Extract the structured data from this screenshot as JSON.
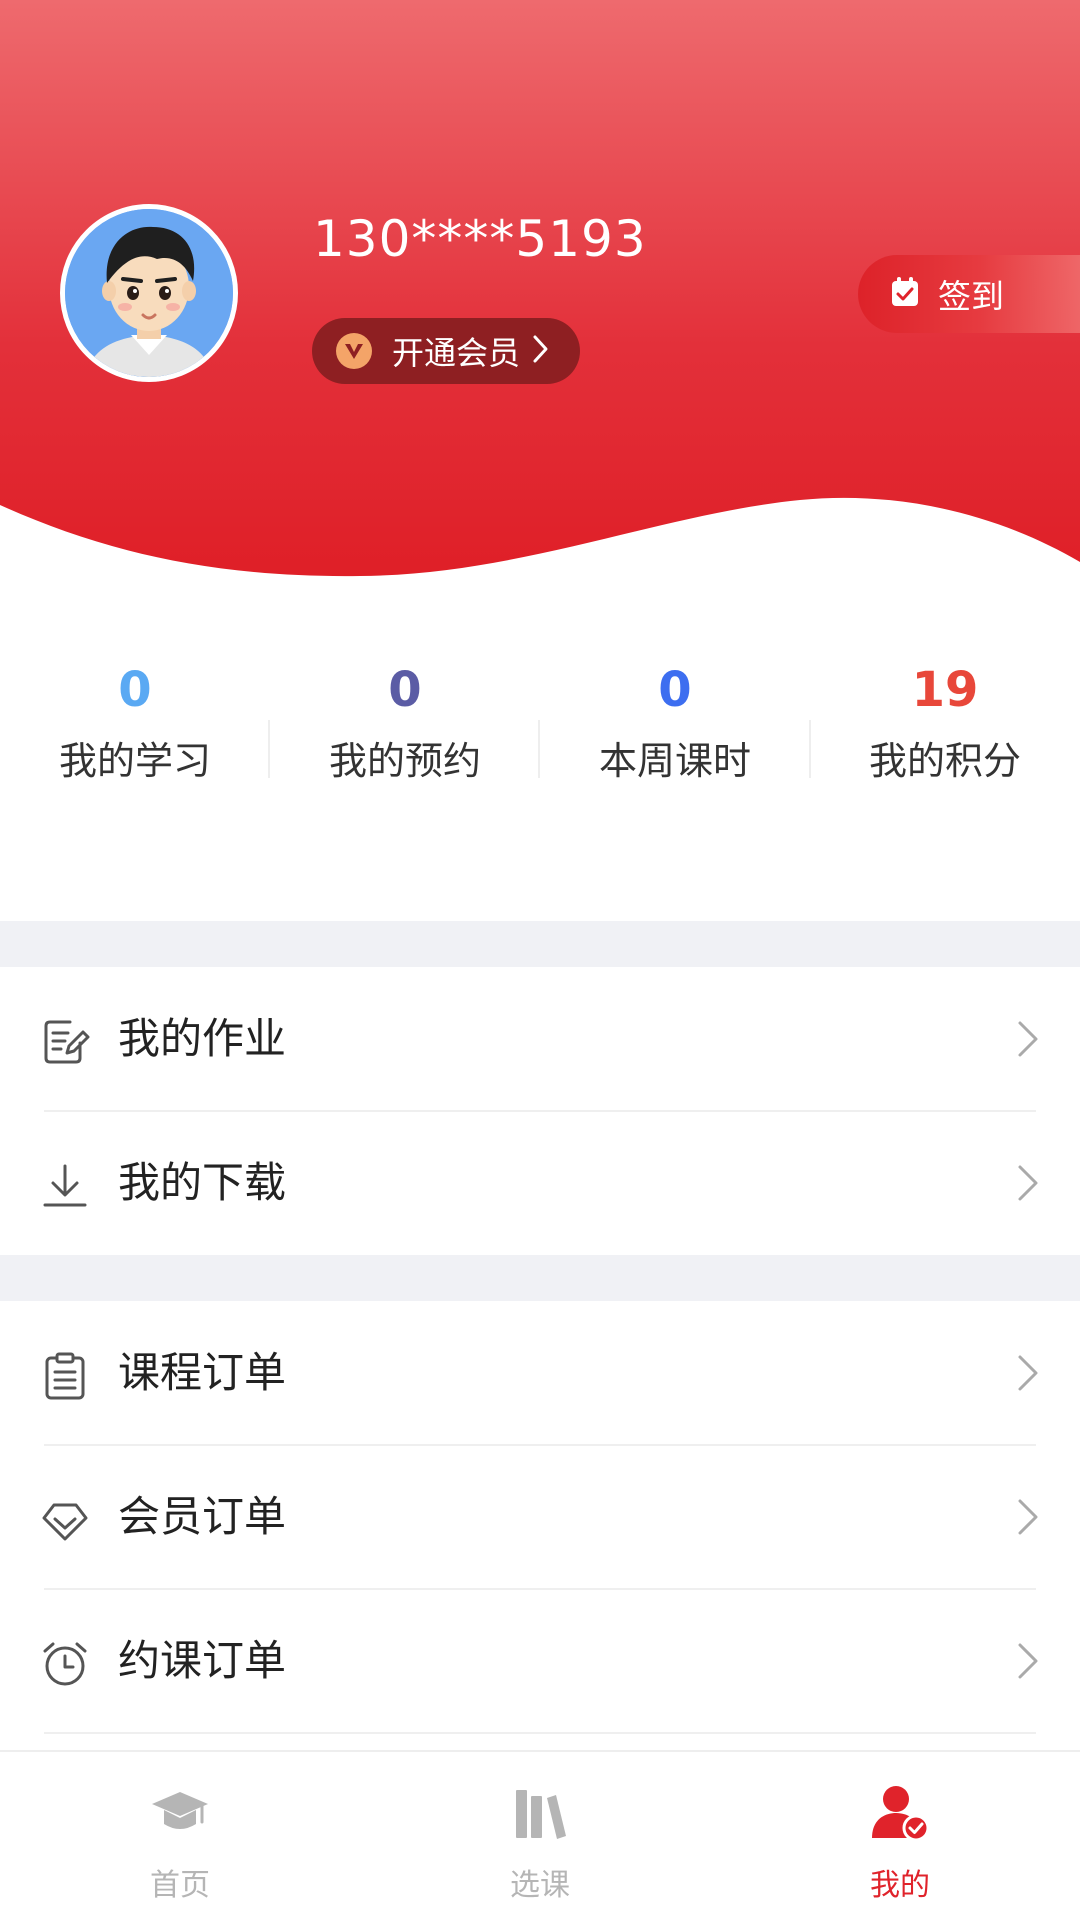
{
  "colors": {
    "brand_red": "#e0232b",
    "stat_study": "#5aa9f3",
    "stat_appointment": "#5b5ca5",
    "stat_week_hours": "#3d6ef0",
    "stat_points": "#e8473a",
    "tab_active": "#e0232b",
    "tab_inactive": "#b5b5b5"
  },
  "header": {
    "phone": "130****5193",
    "vip_button": {
      "label": "开通会员",
      "icon": "vip-v-icon"
    },
    "signin_button": {
      "label": "签到",
      "icon": "calendar-check-icon"
    }
  },
  "stats": [
    {
      "value": "0",
      "label": "我的学习"
    },
    {
      "value": "0",
      "label": "我的预约"
    },
    {
      "value": "0",
      "label": "本周课时"
    },
    {
      "value": "19",
      "label": "我的积分"
    }
  ],
  "menu_group_1": [
    {
      "label": "我的作业",
      "icon": "homework-edit-icon"
    },
    {
      "label": "我的下载",
      "icon": "download-icon"
    }
  ],
  "menu_group_2": [
    {
      "label": "课程订单",
      "icon": "clipboard-list-icon"
    },
    {
      "label": "会员订单",
      "icon": "diamond-icon"
    },
    {
      "label": "约课订单",
      "icon": "alarm-clock-icon"
    }
  ],
  "tabbar": {
    "active": "我的",
    "tabs": [
      {
        "label": "首页",
        "icon": "graduation-cap-icon"
      },
      {
        "label": "选课",
        "icon": "books-icon"
      },
      {
        "label": "我的",
        "icon": "user-check-icon"
      }
    ]
  }
}
